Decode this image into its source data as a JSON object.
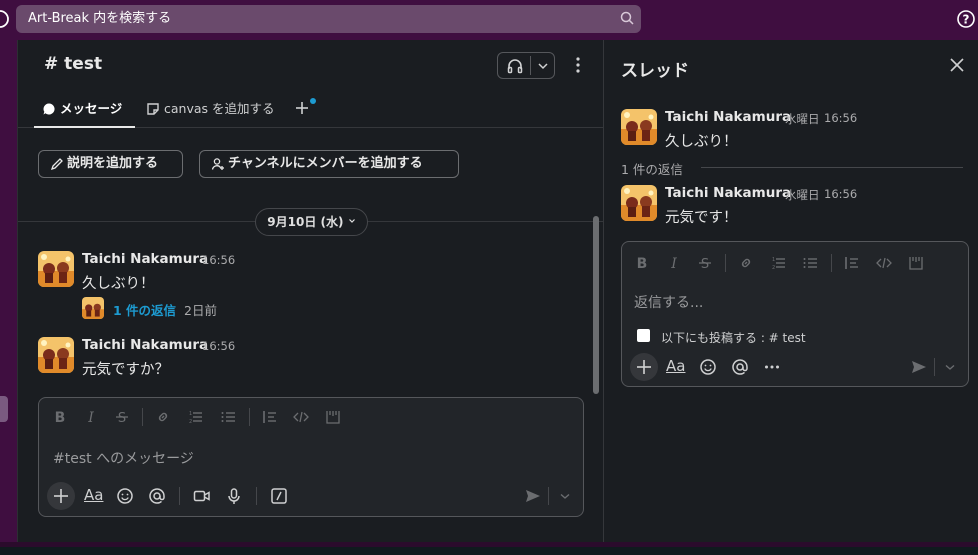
{
  "topbar": {
    "search_placeholder": "Art-Break 内を検索する"
  },
  "channel": {
    "title": "# test",
    "tabs": [
      {
        "label": "メッセージ"
      },
      {
        "label": "canvas を追加する"
      }
    ],
    "actions": {
      "add_description": "説明を追加する",
      "add_members": "チャンネルにメンバーを追加する"
    },
    "date_divider": "9月10日 (水)",
    "messages": [
      {
        "author": "Taichi Nakamura",
        "time": "16:56",
        "text": "久しぶり！",
        "reply_link": "1 件の返信",
        "reply_ago": "2日前"
      },
      {
        "author": "Taichi Nakamura",
        "time": "16:56",
        "text": "元気ですか？"
      }
    ],
    "composer_placeholder": "#test へのメッセージ",
    "text_format_label": "Aa"
  },
  "thread": {
    "title": "スレッド",
    "parent": {
      "author": "Taichi Nakamura",
      "day": "水曜日",
      "time": "16:56",
      "text": "久しぶり！"
    },
    "reply_count_label": "1 件の返信",
    "replies": [
      {
        "author": "Taichi Nakamura",
        "day": "水曜日",
        "time": "16:56",
        "text": "元気です！"
      }
    ],
    "composer_placeholder": "返信する...",
    "also_post_label": "以下にも投稿する : # test",
    "text_format_label": "Aa"
  },
  "colors": {
    "workspace_bar": "#3f0e40",
    "background": "#1a1d21",
    "link": "#1d9bd1"
  }
}
